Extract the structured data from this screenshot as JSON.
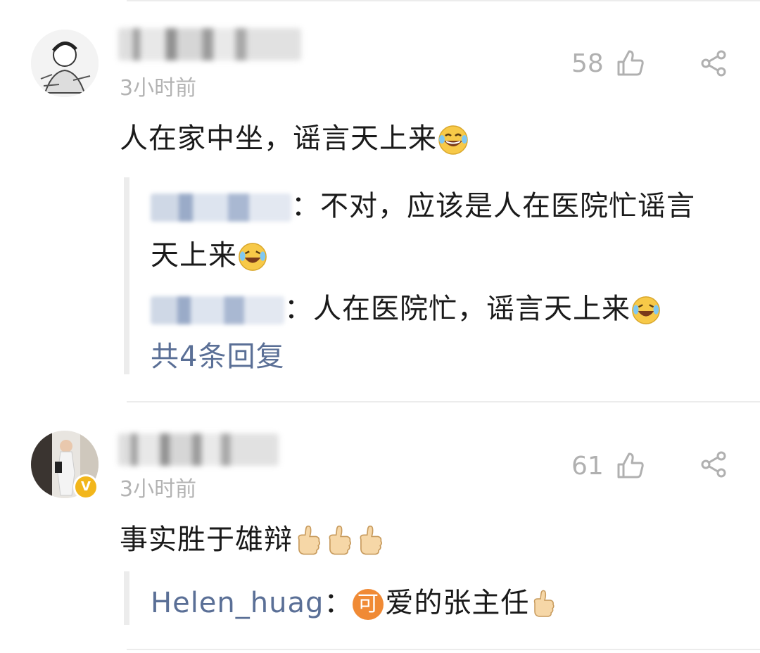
{
  "comments": [
    {
      "time": "3小时前",
      "likes": "58",
      "text": "人在家中坐，谣言天上来",
      "replies": [
        {
          "text": "：不对，应该是人在医院忙谣言"
        },
        {
          "text_cont": "天上来"
        },
        {
          "text": "：人在医院忙，谣言天上来"
        }
      ],
      "more_replies": "共4条回复"
    },
    {
      "time": "3小时前",
      "likes": "61",
      "text": "事实胜于雄辩",
      "verified_badge": "V",
      "replies": [
        {
          "name": "Helen_huag",
          "sep": "：",
          "badge": "可",
          "text": "爱的张主任"
        }
      ]
    }
  ],
  "icons": {
    "like": "thumbs-up-outline-icon",
    "share": "share-icon",
    "laugh": "laughing-tears-emoji",
    "thumb": "thumbs-up-emoji"
  },
  "colors": {
    "reply_name": "#5a6f96",
    "muted": "#b3b3b3",
    "badge": "#f08a35"
  }
}
